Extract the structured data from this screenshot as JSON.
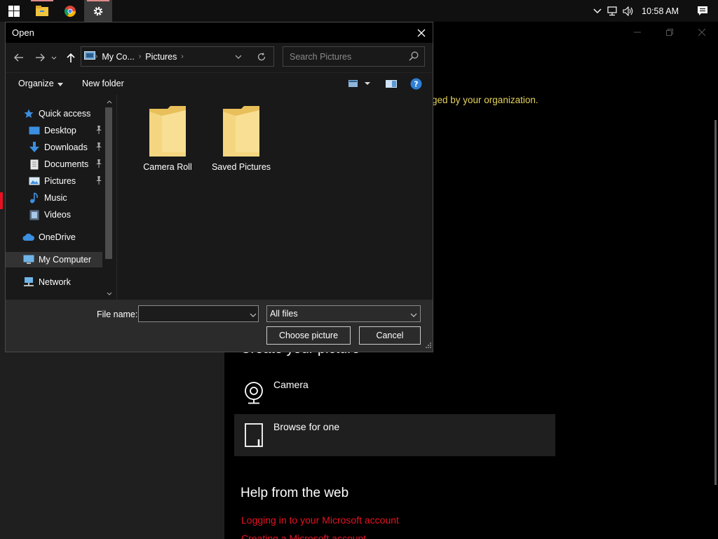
{
  "taskbar": {
    "clock": "10:58 AM",
    "apps": [
      "start-icon",
      "file-explorer-icon",
      "chrome-icon",
      "settings-icon"
    ]
  },
  "settings_window": {
    "org_note": "ged by your organization.",
    "create_title": "Create your picture",
    "options": [
      {
        "label": "Camera",
        "icon": "camera-icon"
      },
      {
        "label": "Browse for one",
        "icon": "browse-icon"
      }
    ],
    "help_title": "Help from the web",
    "help_links": [
      "Logging in to your Microsoft account",
      "Creating a Microsoft account"
    ]
  },
  "dialog": {
    "title": "Open",
    "address": {
      "crumbs": [
        "My Co...",
        "Pictures"
      ]
    },
    "search_placeholder": "Search Pictures",
    "toolbar": {
      "organize": "Organize",
      "new_folder": "New folder"
    },
    "tree": {
      "items": [
        {
          "label": "Quick access",
          "icon": "star-icon",
          "pinned": false
        },
        {
          "label": "Desktop",
          "icon": "desktop-icon",
          "pinned": true
        },
        {
          "label": "Downloads",
          "icon": "download-icon",
          "pinned": true
        },
        {
          "label": "Documents",
          "icon": "document-icon",
          "pinned": true
        },
        {
          "label": "Pictures",
          "icon": "pictures-icon",
          "pinned": true
        },
        {
          "label": "Music",
          "icon": "music-icon",
          "pinned": false
        },
        {
          "label": "Videos",
          "icon": "video-icon",
          "pinned": false
        },
        {
          "label": "OneDrive",
          "icon": "cloud-icon",
          "pinned": false
        },
        {
          "label": "My Computer",
          "icon": "computer-icon",
          "pinned": false
        },
        {
          "label": "Network",
          "icon": "network-icon",
          "pinned": false
        }
      ]
    },
    "files": [
      {
        "name": "Camera Roll",
        "icon": "folder-icon"
      },
      {
        "name": "Saved Pictures",
        "icon": "folder-icon"
      }
    ],
    "file_name_label": "File name:",
    "file_name_value": "",
    "file_type": "All files",
    "buttons": {
      "choose": "Choose picture",
      "cancel": "Cancel"
    }
  },
  "colors": {
    "accent_red": "#e81123",
    "note_yellow": "#e6d25a",
    "folder_yellow": "#f3d27a"
  }
}
